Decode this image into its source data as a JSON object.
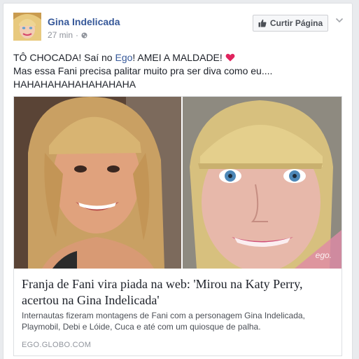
{
  "post": {
    "page_name": "Gina Indelicada",
    "time": "27 min",
    "separator": "·",
    "like_button_label": "Curtir Página",
    "text_line1_before_link": "TÔ CHOCADA! Saí no ",
    "text_link": "Ego",
    "text_line1_after_link": "! AMEI A MALDADE! ",
    "text_line2": "Mas essa Fani precisa palitar muito pra ser diva como eu....",
    "text_line3": "HAHAHAHAHAHAHAHAHA"
  },
  "attachment": {
    "watermark": "ego.",
    "title": "Franja de Fani vira piada na web: 'Mirou na Katy Perry, acertou na Gina Indelicada'",
    "description": "Internautas fizeram montagens de Fani com a personagem Gina Indelicada, Playmobil, Debi e Lóide, Cuca e até com um quiosque de palha.",
    "domain": "EGO.GLOBO.COM"
  },
  "icons": {
    "avatar": "gina-avatar",
    "globe": "globe-icon",
    "thumbs_up": "thumbs-up-icon",
    "chevron": "chevron-down-icon",
    "heart": "heart-icon"
  },
  "colors": {
    "link_blue": "#365899",
    "heart_red": "#e0245e",
    "text_dark": "#1d2129",
    "meta_grey": "#90949c"
  }
}
